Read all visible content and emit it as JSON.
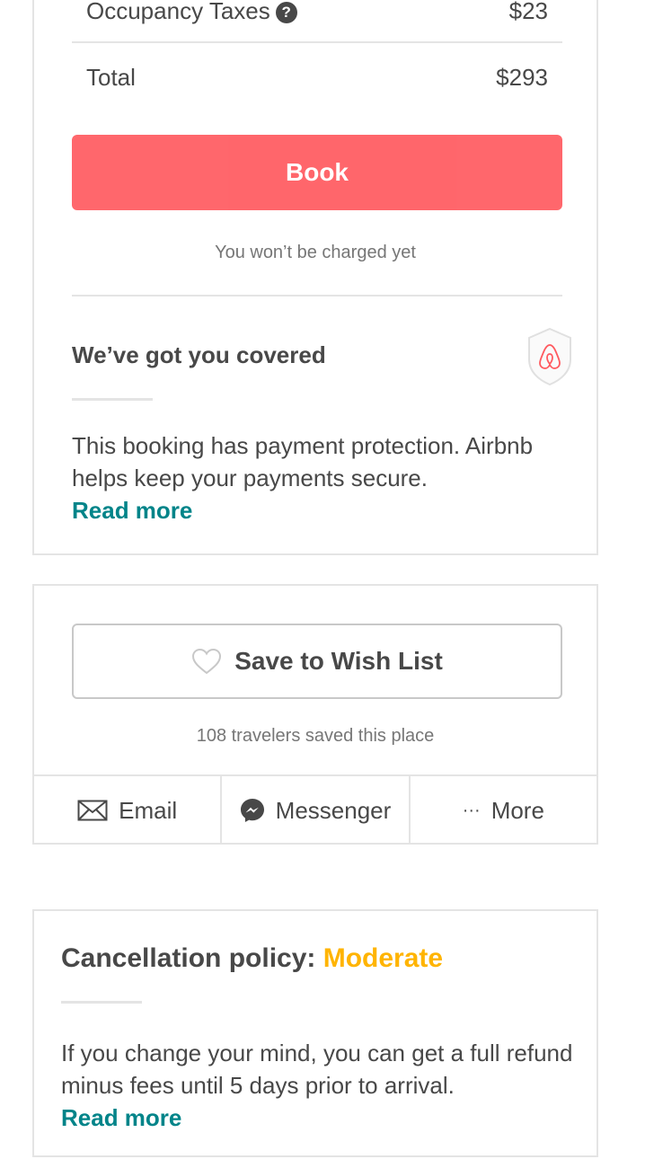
{
  "booking": {
    "taxes_label": "Occupancy Taxes",
    "taxes_help_icon": "question-circle-icon",
    "taxes_value": "$23",
    "total_label": "Total",
    "total_value": "$293",
    "book_label": "Book",
    "charge_note": "You won’t be charged yet",
    "accent_color": "#ff5a5f"
  },
  "protection": {
    "title": "We’ve got you covered",
    "shield_icon": "airbnb-shield-icon",
    "text": "This booking has payment protection. Airbnb helps keep your payments secure.",
    "read_more": "Read more",
    "link_color": "#008489"
  },
  "wishlist": {
    "heart_icon": "heart-outline-icon",
    "save_label": "Save to Wish List",
    "saved_count": "108 travelers saved this place",
    "share": [
      {
        "icon": "email-icon",
        "label": "Email"
      },
      {
        "icon": "messenger-icon",
        "label": "Messenger"
      },
      {
        "icon": "more-dots-icon",
        "label": "More"
      }
    ]
  },
  "cancellation": {
    "title": "Cancellation policy:",
    "level": "Moderate",
    "level_color": "#ffb400",
    "text": "If you change your mind, you can get a full refund minus fees until 5 days prior to arrival.",
    "read_more": "Read more"
  }
}
